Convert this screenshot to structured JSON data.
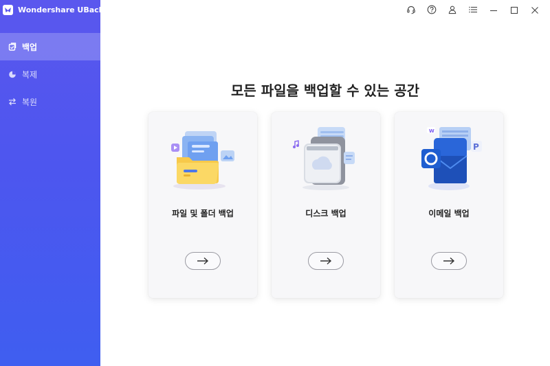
{
  "app": {
    "title": "Wondershare UBackit",
    "accent": "#4f55ee"
  },
  "sidebar": {
    "items": [
      {
        "label": "백업",
        "icon": "backup-icon",
        "active": true
      },
      {
        "label": "복제",
        "icon": "clone-icon",
        "active": false
      },
      {
        "label": "복원",
        "icon": "restore-icon",
        "active": false
      }
    ]
  },
  "titlebar": {
    "controls": [
      "headset-icon",
      "help-icon",
      "user-icon",
      "menu-icon",
      "minimize-icon",
      "maximize-icon",
      "close-icon"
    ]
  },
  "main": {
    "title": "모든 파일을 백업할 수 있는 공간",
    "cards": [
      {
        "label": "파일 및 폴더 백업",
        "icon": "folder-illustration"
      },
      {
        "label": "디스크 백업",
        "icon": "disk-illustration"
      },
      {
        "label": "이메일 백업",
        "icon": "outlook-illustration"
      }
    ],
    "arrow_icon": "arrow-right-icon"
  }
}
